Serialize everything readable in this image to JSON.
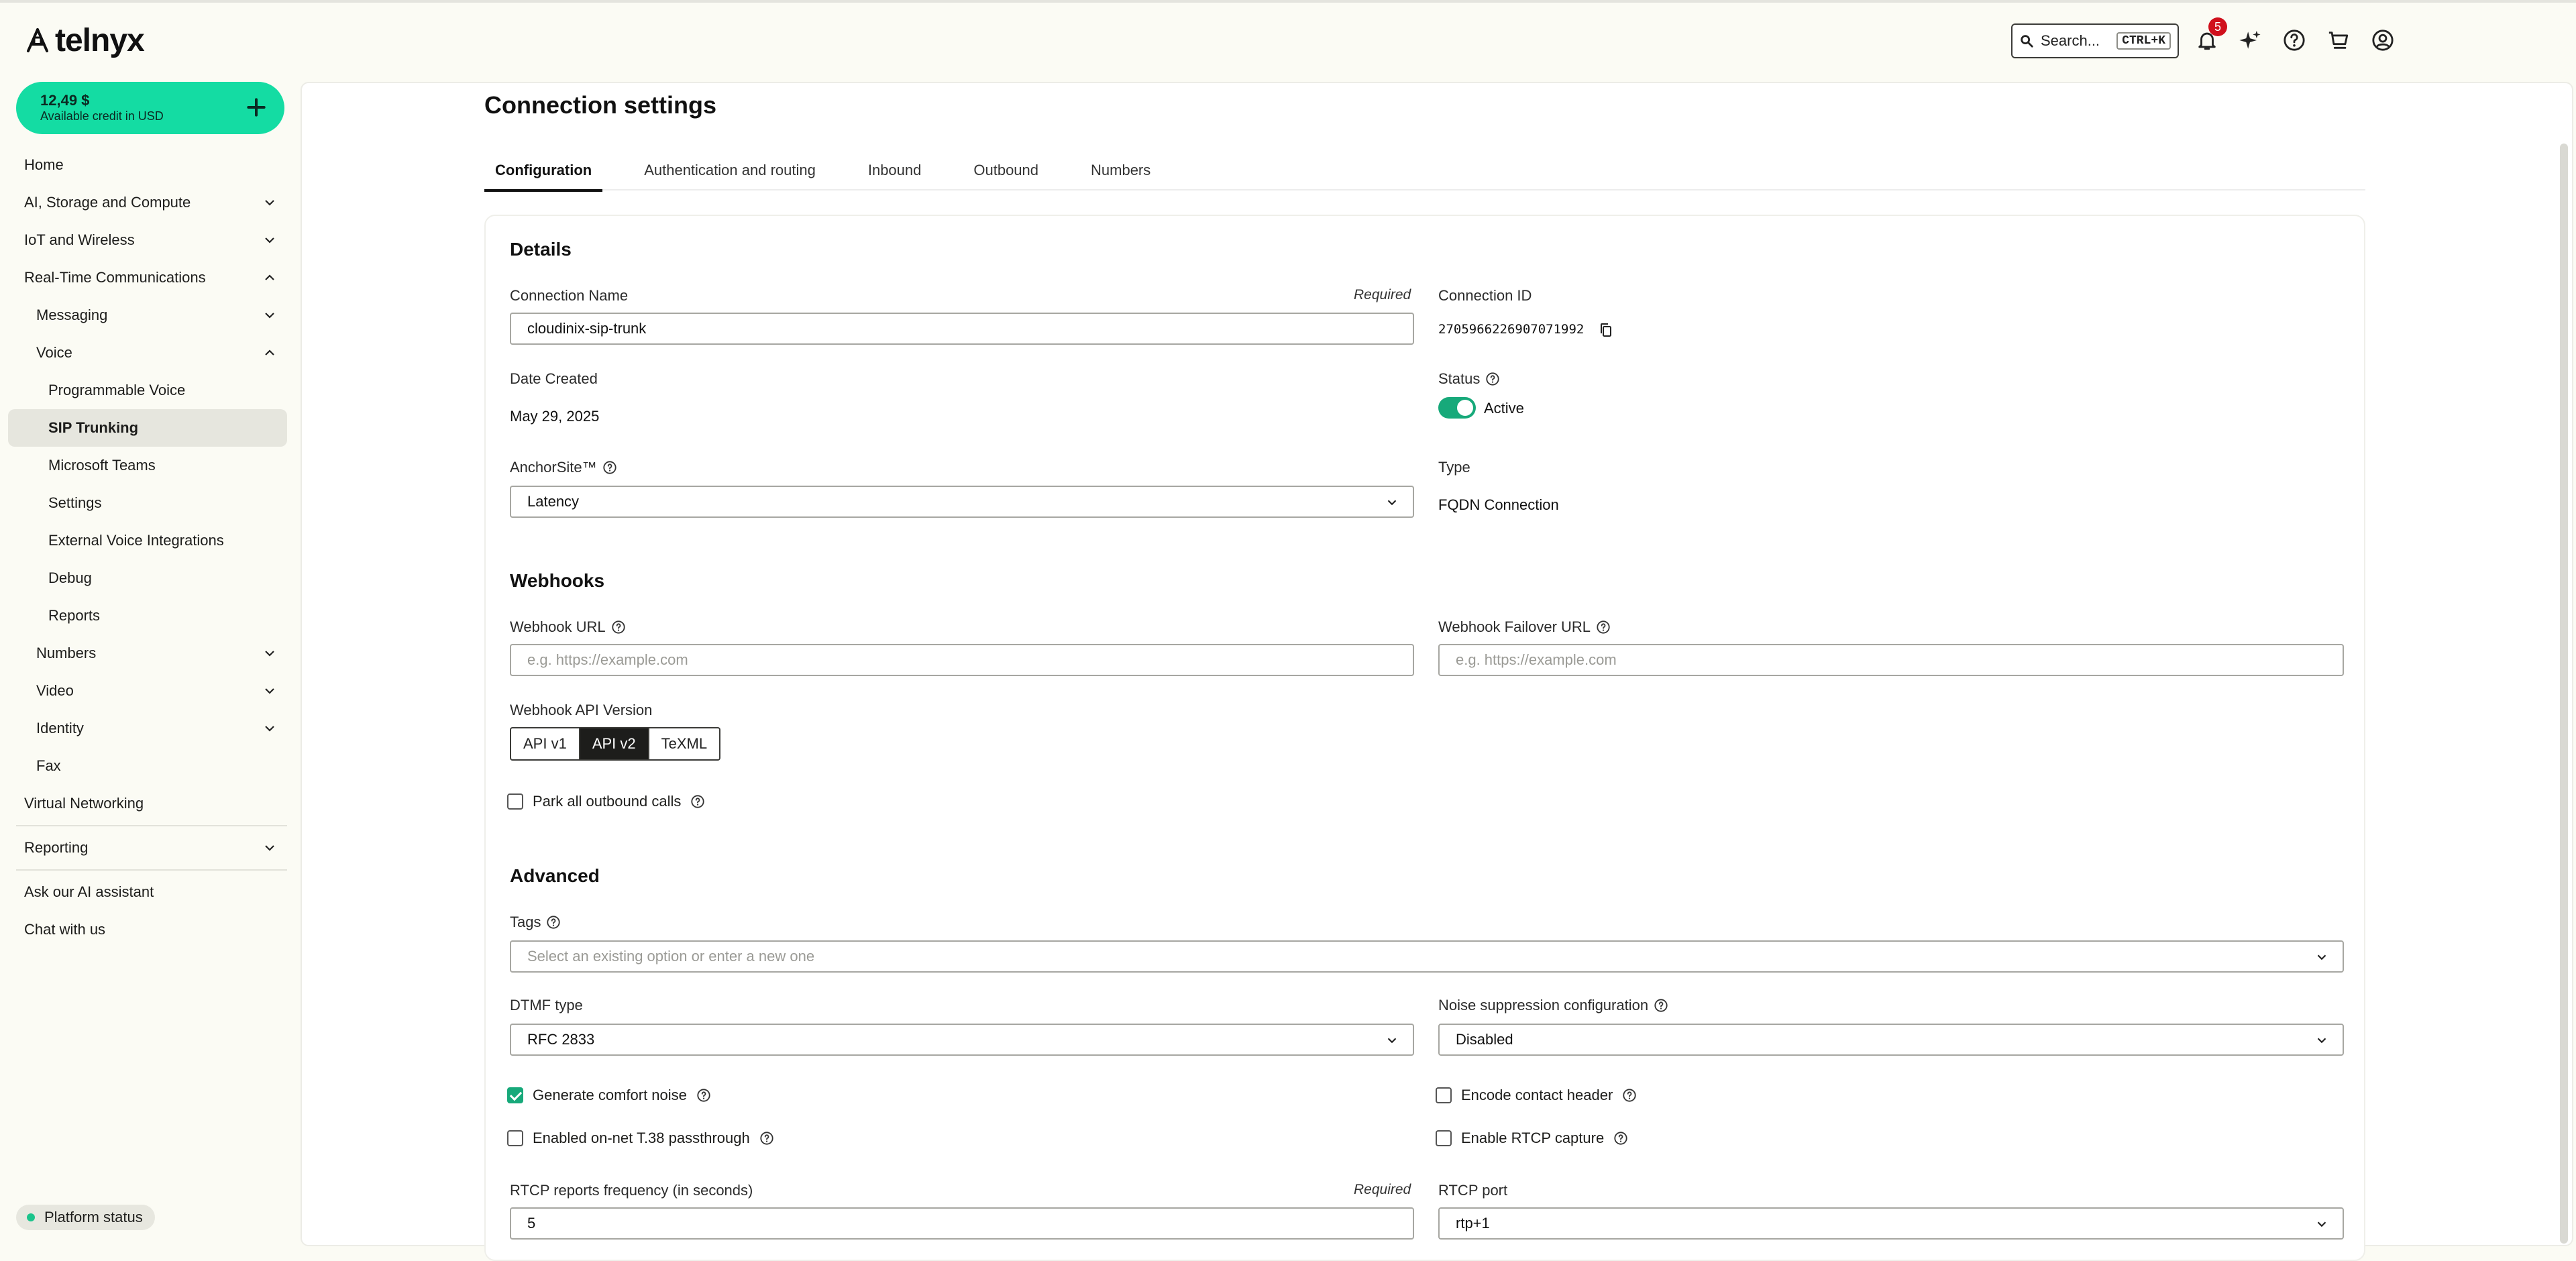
{
  "brand": {
    "name": "telnyx"
  },
  "header": {
    "search_label": "Search...",
    "search_shortcut": "CTRL+K",
    "notifications_count": "5",
    "icons": [
      "bell-icon",
      "sparkle-icon",
      "help-icon",
      "cart-icon",
      "account-icon"
    ]
  },
  "credit": {
    "amount": "12,49 $",
    "label": "Available credit in USD"
  },
  "sidebar": {
    "items": [
      {
        "label": "Home"
      },
      {
        "label": "AI, Storage and Compute"
      },
      {
        "label": "IoT and Wireless"
      },
      {
        "label": "Real-Time Communications"
      },
      {
        "label": "Messaging"
      },
      {
        "label": "Voice"
      },
      {
        "label": "Programmable Voice"
      },
      {
        "label": "SIP Trunking"
      },
      {
        "label": "Microsoft Teams"
      },
      {
        "label": "Settings"
      },
      {
        "label": "External Voice Integrations"
      },
      {
        "label": "Debug"
      },
      {
        "label": "Reports"
      },
      {
        "label": "Numbers"
      },
      {
        "label": "Video"
      },
      {
        "label": "Identity"
      },
      {
        "label": "Fax"
      },
      {
        "label": "Virtual Networking"
      },
      {
        "label": "Reporting"
      },
      {
        "label": "Ask our AI assistant"
      },
      {
        "label": "Chat with us"
      }
    ],
    "platform_status": "Platform status"
  },
  "page": {
    "title": "Connection settings",
    "tabs": [
      {
        "label": "Configuration"
      },
      {
        "label": "Authentication and routing"
      },
      {
        "label": "Inbound"
      },
      {
        "label": "Outbound"
      },
      {
        "label": "Numbers"
      }
    ]
  },
  "details": {
    "title": "Details",
    "connection_name_label": "Connection Name",
    "required": "Required",
    "connection_name_value": "cloudinix-sip-trunk",
    "connection_id_label": "Connection ID",
    "connection_id_value": "2705966226907071992",
    "date_created_label": "Date Created",
    "date_created_value": "May 29, 2025",
    "status_label": "Status",
    "status_value": "Active",
    "anchorsite_label": "AnchorSite™",
    "anchorsite_value": "Latency",
    "type_label": "Type",
    "type_value": "FQDN Connection"
  },
  "webhooks": {
    "title": "Webhooks",
    "url_label": "Webhook URL",
    "url_placeholder": "e.g. https://example.com",
    "failover_label": "Webhook Failover URL",
    "failover_placeholder": "e.g. https://example.com",
    "api_version_label": "Webhook API Version",
    "api_versions": [
      "API v1",
      "API v2",
      "TeXML"
    ],
    "api_selected": "API v2",
    "park_label": "Park all outbound calls"
  },
  "advanced": {
    "title": "Advanced",
    "tags_label": "Tags",
    "tags_placeholder": "Select an existing option or enter a new one",
    "dtmf_label": "DTMF type",
    "dtmf_value": "RFC 2833",
    "noise_label": "Noise suppression configuration",
    "noise_value": "Disabled",
    "comfort_noise_label": "Generate comfort noise",
    "comfort_noise_checked": true,
    "encode_contact_label": "Encode contact header",
    "t38_label": "Enabled on-net T.38 passthrough",
    "rtcp_capture_label": "Enable RTCP capture",
    "rtcp_freq_label": "RTCP reports frequency (in seconds)",
    "rtcp_freq_value": "5",
    "rtcp_port_label": "RTCP port",
    "rtcp_port_value": "rtp+1"
  },
  "colors": {
    "accent": "#14dca3",
    "toggle": "#17a97a",
    "badge": "#d0101c"
  }
}
